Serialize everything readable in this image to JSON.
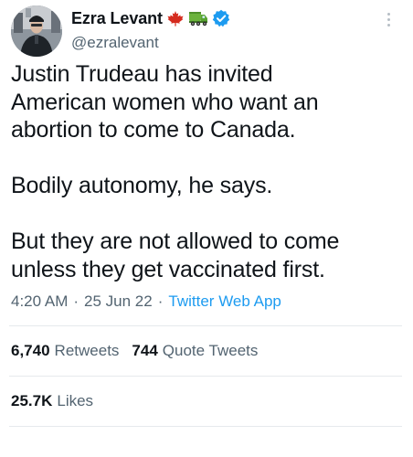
{
  "author": {
    "display_name": "Ezra Levant",
    "handle": "@ezralevant",
    "flag_icon": "maple-leaf-icon",
    "truck_icon": "truck-icon",
    "verified_icon": "verified-badge-icon",
    "avatar": "avatar"
  },
  "tweet": {
    "paragraphs": [
      "Justin Trudeau has invited\nAmerican women who want an\nabortion to come to Canada.",
      "Bodily autonomy, he says.",
      "But they are not allowed to come\nunless they get vaccinated first."
    ],
    "time": "4:20 AM",
    "date": "25 Jun 22",
    "source": "Twitter Web App",
    "separator": "·"
  },
  "stats": {
    "retweets_count": "6,740",
    "retweets_label": "Retweets",
    "quote_tweets_count": "744",
    "quote_tweets_label": "Quote Tweets",
    "likes_count": "25.7K",
    "likes_label": "Likes"
  },
  "colors": {
    "text_primary": "#0f1419",
    "text_secondary": "#536471",
    "link_blue": "#1d9bf0",
    "verified_blue": "#1d9bf0",
    "maple_red": "#d52b1e",
    "truck_green": "#5aa832"
  }
}
